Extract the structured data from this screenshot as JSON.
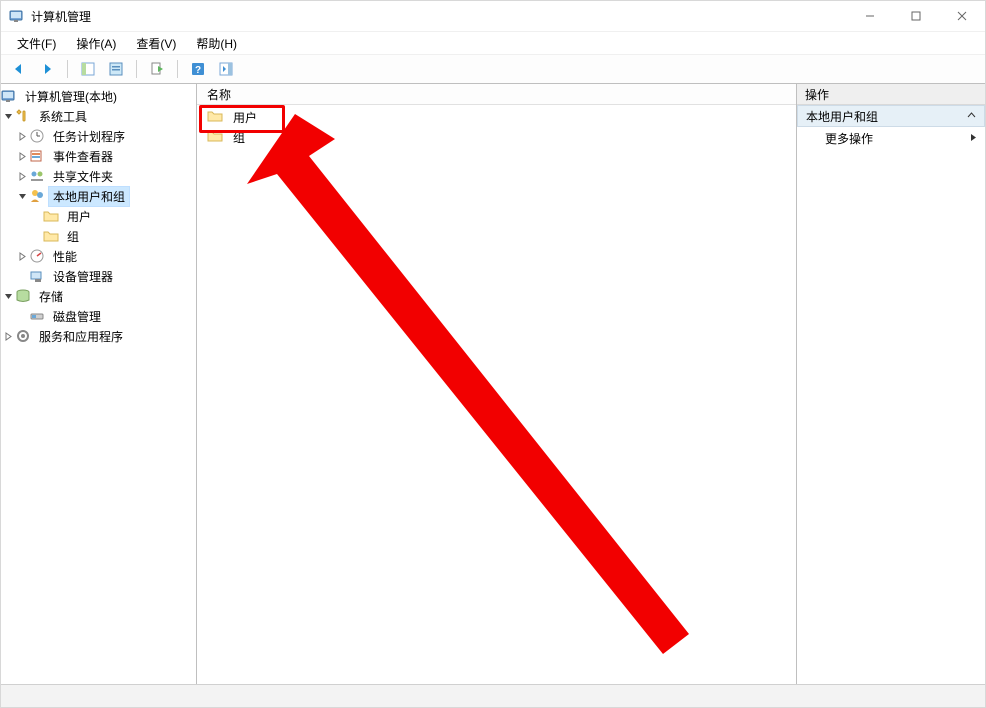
{
  "titlebar": {
    "title": "计算机管理"
  },
  "menubar": {
    "items": [
      "文件(F)",
      "操作(A)",
      "查看(V)",
      "帮助(H)"
    ]
  },
  "tree": {
    "root_label": "计算机管理(本地)",
    "nodes": [
      {
        "label": "系统工具",
        "expanded": true,
        "icon": "tools",
        "level": 1,
        "children": [
          {
            "label": "任务计划程序",
            "expanded": false,
            "icon": "sched",
            "level": 2,
            "has_children": true
          },
          {
            "label": "事件查看器",
            "expanded": false,
            "icon": "event",
            "level": 2,
            "has_children": true
          },
          {
            "label": "共享文件夹",
            "expanded": false,
            "icon": "share",
            "level": 2,
            "has_children": true
          },
          {
            "label": "本地用户和组",
            "expanded": true,
            "icon": "users",
            "level": 2,
            "selected": true,
            "children": [
              {
                "label": "用户",
                "icon": "folder",
                "level": 3
              },
              {
                "label": "组",
                "icon": "folder",
                "level": 3
              }
            ]
          },
          {
            "label": "性能",
            "expanded": false,
            "icon": "perf",
            "level": 2,
            "has_children": true
          },
          {
            "label": "设备管理器",
            "expanded": false,
            "icon": "device",
            "level": 2
          }
        ]
      },
      {
        "label": "存储",
        "expanded": true,
        "icon": "storage",
        "level": 1,
        "children": [
          {
            "label": "磁盘管理",
            "icon": "disk",
            "level": 2
          }
        ]
      },
      {
        "label": "服务和应用程序",
        "expanded": false,
        "icon": "services",
        "level": 1,
        "has_children": true
      }
    ]
  },
  "list": {
    "header": "名称",
    "items": [
      {
        "label": "用户",
        "highlighted": true
      },
      {
        "label": "组"
      }
    ]
  },
  "actions": {
    "header": "操作",
    "group": "本地用户和组",
    "more": "更多操作"
  }
}
